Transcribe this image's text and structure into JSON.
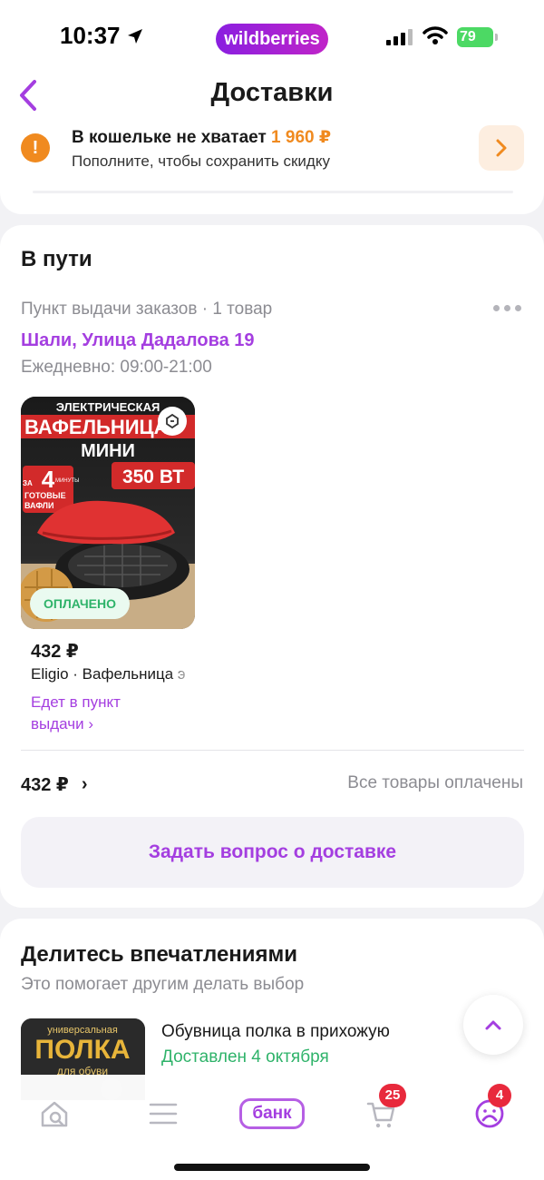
{
  "status_bar": {
    "time": "10:37",
    "app_pill": "wildberries",
    "battery": "79"
  },
  "header": {
    "title": "Доставки"
  },
  "wallet": {
    "title": "В кошельке не хватает",
    "amount": "1 960 ₽",
    "subtitle": "Пополните, чтобы сохранить скидку"
  },
  "transit": {
    "section_title": "В пути",
    "pickup_meta": "Пункт выдачи заказов · 1 товар",
    "address": "Шали, Улица Дадалова 19",
    "hours": "Ежедневно: 09:00-21:00",
    "product": {
      "image_text": {
        "line1": "ЭЛЕКТРИЧЕСКАЯ",
        "line2": "ВАФЕЛЬНИЦА",
        "line3": "МИНИ",
        "power": "350 ВТ",
        "num": "4",
        "side_a": "ЗА",
        "side_b": "МИНУТЫ",
        "side_c": "ГОТОВЫЕ",
        "side_d": "ВАФЛИ"
      },
      "paid_badge": "ОПЛАЧЕНО",
      "price": "432 ₽",
      "name": "Eligio · Вафельница э",
      "status": "Едет в пункт выдачи ›"
    },
    "total": "432 ₽",
    "all_paid": "Все товары оплачены",
    "ask_button": "Задать вопрос о доставке"
  },
  "feedback": {
    "title": "Делитесь впечатлениями",
    "subtitle": "Это помогает другим делать выбор",
    "item_name": "Обувница полка в прихожую",
    "item_status": "Доставлен 4 октября",
    "thumb_text": {
      "line1": "универсальная",
      "line2": "ПОЛКА",
      "line3": "для обуви"
    }
  },
  "tab_bar": {
    "bank_label": "банк",
    "cart_badge": "25",
    "profile_badge": "4"
  },
  "colors": {
    "accent": "#a43ee0",
    "warning": "#f08a1f",
    "success": "#2fb36a",
    "badge": "#e8293c"
  }
}
